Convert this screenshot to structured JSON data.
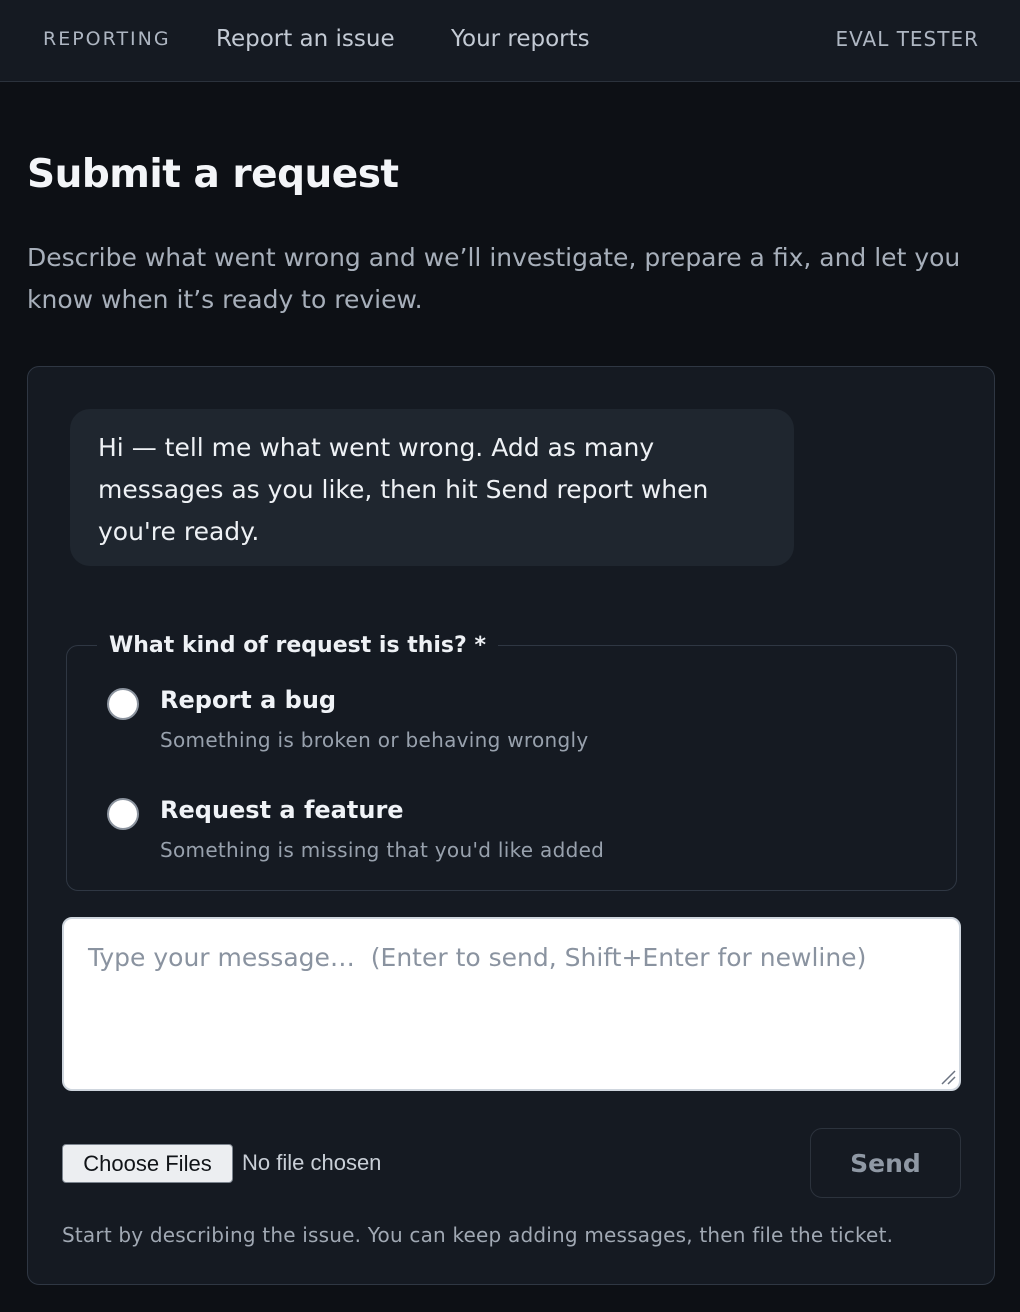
{
  "nav": {
    "brand": "REPORTING",
    "links": [
      {
        "label": "Report an issue"
      },
      {
        "label": "Your reports"
      }
    ],
    "user": "EVAL TESTER"
  },
  "page": {
    "title": "Submit a request",
    "description": "Describe what went wrong and we’ll investigate, prepare a fix, and let you know when it’s ready to review."
  },
  "chat": {
    "greeting": "Hi — tell me what went wrong. Add as many messages as you like, then hit Send report when you're ready."
  },
  "request_type": {
    "legend": "What kind of request is this? *",
    "options": [
      {
        "label": "Report a bug",
        "description": "Something is broken or behaving wrongly",
        "selected": false
      },
      {
        "label": "Request a feature",
        "description": "Something is missing that you'd like added",
        "selected": false
      }
    ]
  },
  "composer": {
    "value": "",
    "placeholder": "Type your message…  (Enter to send, Shift+Enter for newline)",
    "file_button": "Choose Files",
    "file_status": "No file chosen",
    "send_label": "Send",
    "hint": "Start by describing the issue. You can keep adding messages, then file the ticket."
  },
  "colors": {
    "background": "#0d1015",
    "card": "#151a22",
    "bubble": "#1f262f",
    "border": "#2f3743"
  }
}
